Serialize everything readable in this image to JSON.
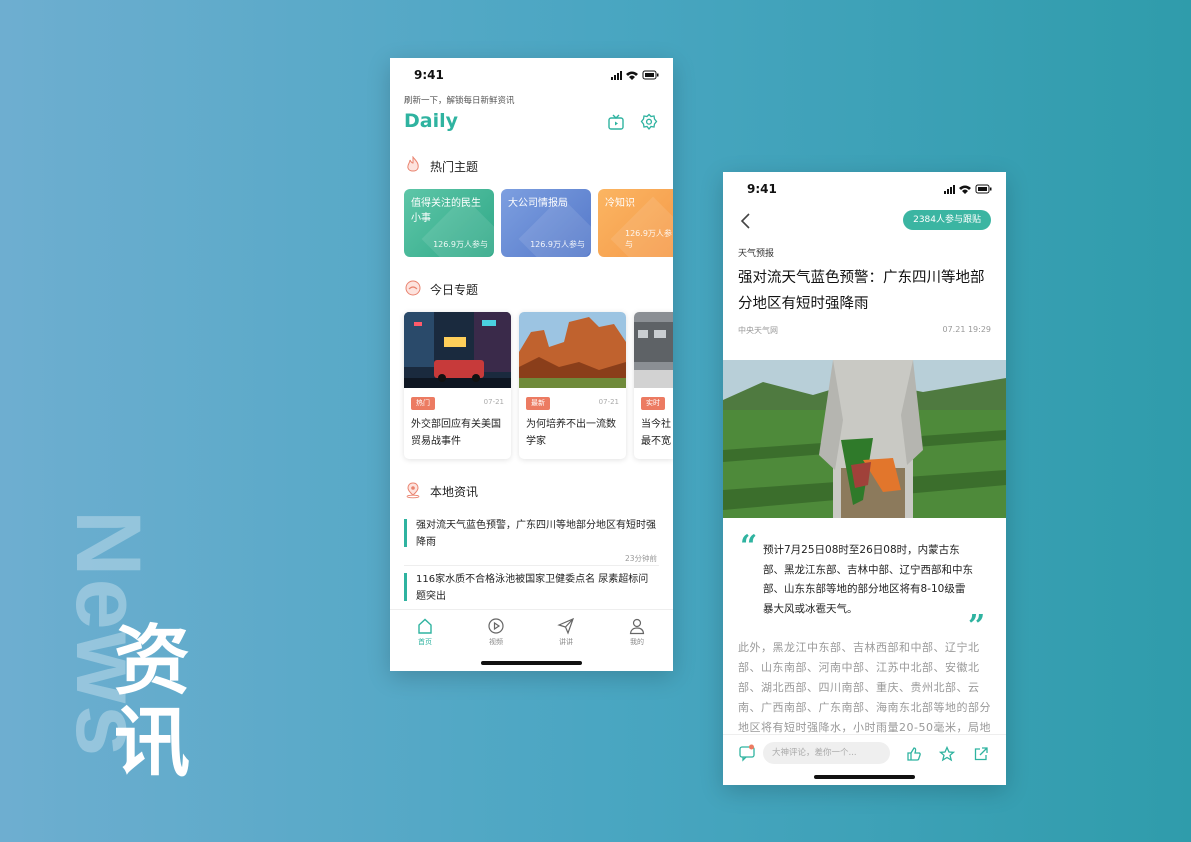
{
  "background": {
    "watermark_en": "News",
    "title_cn": "资讯"
  },
  "colors": {
    "accent": "#2fb3a0",
    "tag": "#ec7b62"
  },
  "home": {
    "status_time": "9:41",
    "greeting": "刷新一下，解锁每日新鲜资讯",
    "logo": "Daily",
    "hot": {
      "title": "热门主题",
      "cards": [
        {
          "title": "值得关注的民生小事",
          "count": "126.9万人参与"
        },
        {
          "title": "大公司情报局",
          "count": "126.9万人参与"
        },
        {
          "title": "冷知识",
          "count": "126.9万人参与"
        }
      ]
    },
    "today": {
      "title": "今日专题",
      "items": [
        {
          "tag": "热门",
          "date": "07-21",
          "title": "外交部回应有关美国贸易战事件"
        },
        {
          "tag": "最新",
          "date": "07-21",
          "title": "为何培养不出一流数学家"
        },
        {
          "tag": "实时",
          "date": "",
          "title": "当今社最不宽"
        }
      ]
    },
    "local": {
      "title": "本地资讯",
      "items": [
        {
          "title": "强对流天气蓝色预警，广东四川等地部分地区有短时强降雨",
          "time": "23分钟前"
        },
        {
          "title": "116家水质不合格泳池被国家卫健委点名 尿素超标问题突出",
          "time": ""
        }
      ]
    },
    "tabs": [
      {
        "label": "首页"
      },
      {
        "label": "视频"
      },
      {
        "label": "讲讲"
      },
      {
        "label": "我的"
      }
    ]
  },
  "article": {
    "status_time": "9:41",
    "follow": "2384人参与跟贴",
    "category": "天气预报",
    "title": "强对流天气蓝色预警：广东四川等地部分地区有短时强降雨",
    "source": "中央天气网",
    "date": "07.21  19:29",
    "quote": "预计7月25日08时至26日08时，内蒙古东部、黑龙江东部、吉林中部、辽宁西部和中东部、山东东部等地的部分地区将有8-10级雷暴大风或冰雹天气。",
    "body": "此外，黑龙江中东部、吉林西部和中部、辽宁北部、山东南部、河南中部、江苏中北部、安徽北部、湖北西部、四川南部、重庆、贵州北部、云南、广西南部、广东南部、海南东北部等地的部分地区将有短时强降水，小时雨量20-50毫米，局地",
    "comment_placeholder": "大神评论，差你一个..."
  }
}
